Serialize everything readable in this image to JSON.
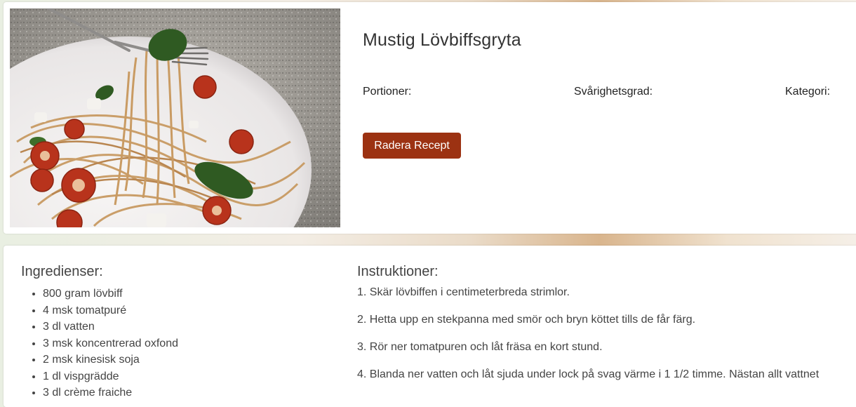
{
  "recipe": {
    "title": "Mustig Lövbiffsgryta",
    "portions_label": "Portioner:",
    "difficulty_label": "Svårighetsgrad:",
    "category_label": "Kategori:",
    "delete_button": "Radera Recept",
    "image_icon": "pasta-photo"
  },
  "ingredients": {
    "heading": "Ingredienser:",
    "items": [
      "800 gram lövbiff",
      "4 msk tomatpuré",
      "3 dl vatten",
      "3 msk koncentrerad oxfond",
      "2 msk kinesisk soja",
      "1 dl vispgrädde",
      "3 dl crème fraiche"
    ]
  },
  "instructions": {
    "heading": "Instruktioner:",
    "steps": [
      "1. Skär lövbiffen i centimeterbreda strimlor.",
      "2. Hetta upp en stekpanna med smör och bryn köttet tills de får färg.",
      "3. Rör ner tomatpuren och låt fräsa en kort stund.",
      "4. Blanda ner vatten och låt sjuda under lock på svag värme i 1 1/2 timme. Nästan allt vattnet"
    ]
  },
  "colors": {
    "button_bg": "#9c3212",
    "text": "#333333"
  }
}
